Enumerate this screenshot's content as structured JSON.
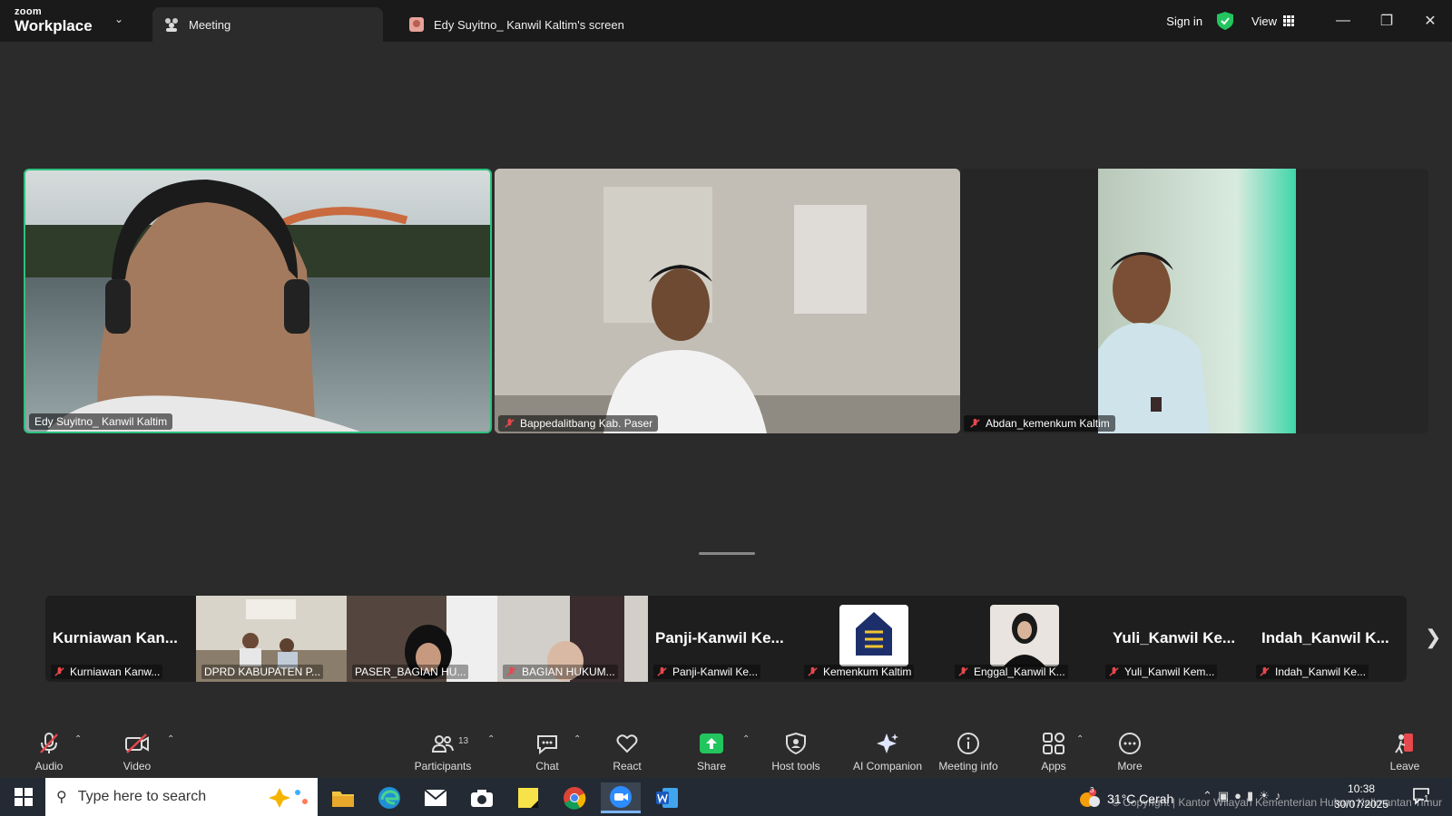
{
  "app": {
    "brand_small": "zoom",
    "brand_big": "Workplace",
    "tabs": [
      {
        "label": "Meeting"
      },
      {
        "label": "Edy Suyitno_ Kanwil Kaltim's screen"
      }
    ],
    "sign_in": "Sign in",
    "view": "View"
  },
  "main_tiles": [
    {
      "name": "Edy Suyitno_ Kanwil Kaltim",
      "active_speaker": true
    },
    {
      "name": "Bappedalitbang Kab. Paser",
      "muted": true
    },
    {
      "name": "Abdan_kemenkum Kaltim",
      "muted": true
    }
  ],
  "strip": [
    {
      "big": "Kurniawan  Kan...",
      "label": "Kurniawan Kanw..."
    },
    {
      "big": "",
      "label": "DPRD KABUPATEN P..."
    },
    {
      "big": "",
      "label": "PASER_BAGIAN HU..."
    },
    {
      "big": "",
      "label": "BAGIAN HUKUM..."
    },
    {
      "big": "Panji-Kanwil  Ke...",
      "label": "Panji-Kanwil Ke..."
    },
    {
      "big": "",
      "label": "Kemenkum Kaltim"
    },
    {
      "big": "",
      "label": "Enggal_Kanwil K..."
    },
    {
      "big": "Yuli_Kanwil  Ke...",
      "label": "Yuli_Kanwil Kem..."
    },
    {
      "big": "Indah_Kanwil  K...",
      "label": "Indah_Kanwil Ke..."
    }
  ],
  "toolbar": {
    "audio": "Audio",
    "video": "Video",
    "participants": "Participants",
    "participants_count": "13",
    "chat": "Chat",
    "react": "React",
    "share": "Share",
    "host_tools": "Host tools",
    "ai_companion": "AI Companion",
    "meeting_info": "Meeting info",
    "apps": "Apps",
    "more": "More",
    "leave": "Leave"
  },
  "taskbar": {
    "search_placeholder": "Type here to search",
    "weather": "31°C  Cerah",
    "weather_badge": "3",
    "time": "10:38",
    "date": "30/07/2025",
    "notification_count": "1",
    "copyright": "© Copyright | Kantor Wilayah Kementerian Hukum Kalimantan Timur"
  },
  "colors": {
    "active_border": "#2ec27e",
    "share_green": "#22c55e",
    "mute_red": "#e5484d"
  }
}
